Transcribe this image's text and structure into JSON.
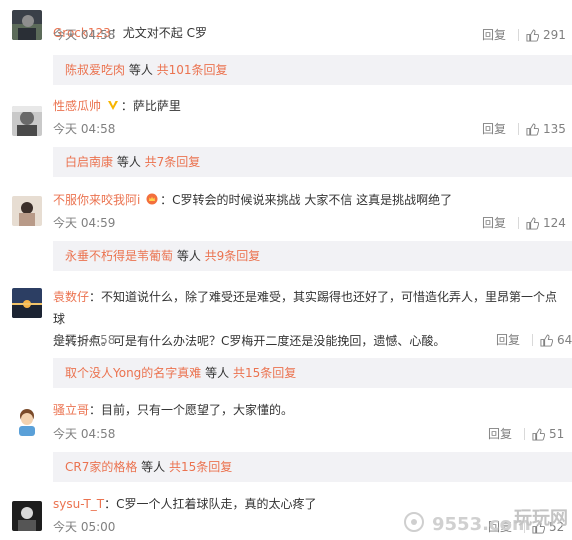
{
  "comments": [
    {
      "name": "Grock123",
      "text": "：尤文对不起 C罗",
      "time": "今天 04:58",
      "reply": "回复",
      "likes": "291",
      "sub": {
        "name": "陈叔爱吃肉",
        "mid": " 等人 ",
        "count": "共101条回复"
      }
    },
    {
      "name": "性感瓜帅",
      "text": "：萨比萨里",
      "time": "今天 04:58",
      "reply": "回复",
      "likes": "135",
      "sub": {
        "name": "白启南康",
        "mid": " 等人 ",
        "count": "共7条回复"
      }
    },
    {
      "name": "不服你来咬我阿i",
      "text": "：C罗转会的时候说来挑战 大家不信 这真是挑战啊绝了",
      "time": "今天 04:59",
      "reply": "回复",
      "likes": "124",
      "sub": {
        "name": "永垂不朽得是苇葡萄",
        "mid": " 等人 ",
        "count": "共9条回复"
      }
    },
    {
      "name": "袁数仔",
      "text": "：不知道说什么，除了难受还是难受，其实踢得也还好了，可惜造化弄人，里昂第一个点球",
      "text2": "是转折点。可是有什么办法呢？C罗梅开二度还是没能挽回，遗憾、心酸。",
      "time": "今天 04:58",
      "reply": "回复",
      "likes": "64",
      "sub": {
        "name": "取个没人Yong的名字真难",
        "mid": " 等人 ",
        "count": "共15条回复"
      }
    },
    {
      "name": "骚立哥",
      "text": "：目前，只有一个愿望了，大家懂的。",
      "time": "今天 04:58",
      "reply": "回复",
      "likes": "51",
      "sub": {
        "name": "CR7家的格格",
        "mid": " 等人 ",
        "count": "共15条回复"
      }
    },
    {
      "name": "sysu-T_T",
      "text": "：C罗一个人扛着球队走，真的太心疼了",
      "time": "今天 05:00",
      "reply": "回复",
      "likes": "52"
    }
  ],
  "icons": {
    "like": "thumbs-up-icon",
    "verified": "verified-v-icon",
    "vip": "vip-crown-icon"
  },
  "colors": {
    "username": "#eb7350",
    "subbox_bg": "#f2f2f5",
    "meta": "#808080"
  },
  "watermark": {
    "text": "玩玩网",
    "url": "9553.com"
  }
}
